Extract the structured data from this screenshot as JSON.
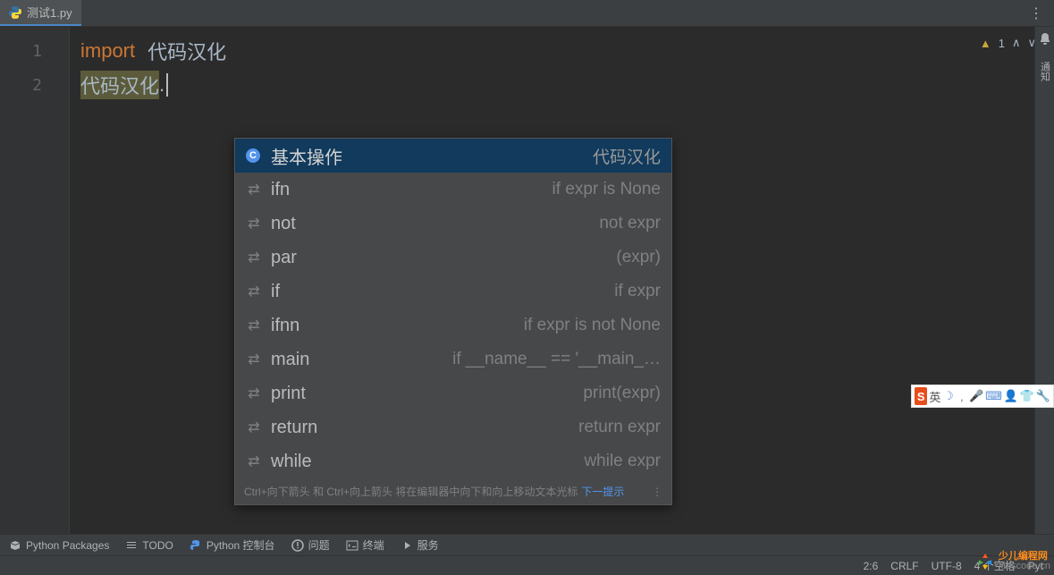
{
  "tab": {
    "filename": "测试1.py"
  },
  "inspection": {
    "warn_count": "1"
  },
  "code": {
    "lines": [
      "1",
      "2"
    ],
    "line1_kw": "import",
    "line1_id": "代码汉化",
    "line2_sel": "代码汉化",
    "line2_dot": "."
  },
  "completion": {
    "items": [
      {
        "icon": "C",
        "name": "基本操作",
        "desc": "代码汉化",
        "selected": true,
        "iconType": "circle"
      },
      {
        "icon": "⇄",
        "name": "ifn",
        "desc": "if expr is None"
      },
      {
        "icon": "⇄",
        "name": "not",
        "desc": "not expr"
      },
      {
        "icon": "⇄",
        "name": "par",
        "desc": "(expr)"
      },
      {
        "icon": "⇄",
        "name": "if",
        "desc": "if expr"
      },
      {
        "icon": "⇄",
        "name": "ifnn",
        "desc": "if expr is not None"
      },
      {
        "icon": "⇄",
        "name": "main",
        "desc": "if __name__ == '__main_…"
      },
      {
        "icon": "⇄",
        "name": "print",
        "desc": "print(expr)"
      },
      {
        "icon": "⇄",
        "name": "return",
        "desc": "return expr"
      },
      {
        "icon": "⇄",
        "name": "while",
        "desc": "while expr"
      }
    ],
    "hint_text": "Ctrl+向下箭头 和 Ctrl+向上箭头 将在编辑器中向下和向上移动文本光标",
    "hint_link": "下一提示"
  },
  "tool_windows": {
    "packages": "Python Packages",
    "todo": "TODO",
    "console": "Python 控制台",
    "problems": "问题",
    "terminal": "终端",
    "services": "服务"
  },
  "status": {
    "pos": "2:6",
    "eol": "CRLF",
    "enc": "UTF-8",
    "indent": "4 个空格",
    "py": "Pyt"
  },
  "sidebar": {
    "label": "通知"
  },
  "ime": {
    "logo": "S",
    "lang": "英"
  },
  "watermark": {
    "t1": "少儿编程网",
    "t2": "kidscode.cn"
  }
}
